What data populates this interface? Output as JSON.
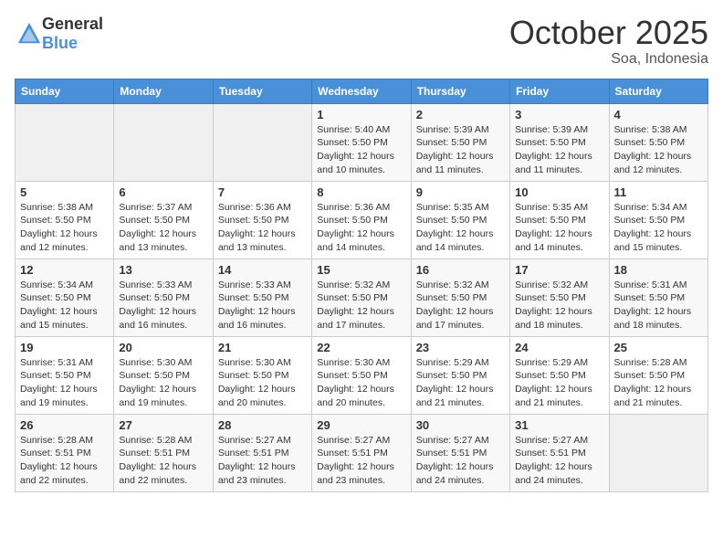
{
  "header": {
    "logo": {
      "general": "General",
      "blue": "Blue"
    },
    "title": "October 2025",
    "location": "Soa, Indonesia"
  },
  "calendar": {
    "weekdays": [
      "Sunday",
      "Monday",
      "Tuesday",
      "Wednesday",
      "Thursday",
      "Friday",
      "Saturday"
    ],
    "weeks": [
      [
        {
          "day": "",
          "info": ""
        },
        {
          "day": "",
          "info": ""
        },
        {
          "day": "",
          "info": ""
        },
        {
          "day": "1",
          "info": "Sunrise: 5:40 AM\nSunset: 5:50 PM\nDaylight: 12 hours\nand 10 minutes."
        },
        {
          "day": "2",
          "info": "Sunrise: 5:39 AM\nSunset: 5:50 PM\nDaylight: 12 hours\nand 11 minutes."
        },
        {
          "day": "3",
          "info": "Sunrise: 5:39 AM\nSunset: 5:50 PM\nDaylight: 12 hours\nand 11 minutes."
        },
        {
          "day": "4",
          "info": "Sunrise: 5:38 AM\nSunset: 5:50 PM\nDaylight: 12 hours\nand 12 minutes."
        }
      ],
      [
        {
          "day": "5",
          "info": "Sunrise: 5:38 AM\nSunset: 5:50 PM\nDaylight: 12 hours\nand 12 minutes."
        },
        {
          "day": "6",
          "info": "Sunrise: 5:37 AM\nSunset: 5:50 PM\nDaylight: 12 hours\nand 13 minutes."
        },
        {
          "day": "7",
          "info": "Sunrise: 5:36 AM\nSunset: 5:50 PM\nDaylight: 12 hours\nand 13 minutes."
        },
        {
          "day": "8",
          "info": "Sunrise: 5:36 AM\nSunset: 5:50 PM\nDaylight: 12 hours\nand 14 minutes."
        },
        {
          "day": "9",
          "info": "Sunrise: 5:35 AM\nSunset: 5:50 PM\nDaylight: 12 hours\nand 14 minutes."
        },
        {
          "day": "10",
          "info": "Sunrise: 5:35 AM\nSunset: 5:50 PM\nDaylight: 12 hours\nand 14 minutes."
        },
        {
          "day": "11",
          "info": "Sunrise: 5:34 AM\nSunset: 5:50 PM\nDaylight: 12 hours\nand 15 minutes."
        }
      ],
      [
        {
          "day": "12",
          "info": "Sunrise: 5:34 AM\nSunset: 5:50 PM\nDaylight: 12 hours\nand 15 minutes."
        },
        {
          "day": "13",
          "info": "Sunrise: 5:33 AM\nSunset: 5:50 PM\nDaylight: 12 hours\nand 16 minutes."
        },
        {
          "day": "14",
          "info": "Sunrise: 5:33 AM\nSunset: 5:50 PM\nDaylight: 12 hours\nand 16 minutes."
        },
        {
          "day": "15",
          "info": "Sunrise: 5:32 AM\nSunset: 5:50 PM\nDaylight: 12 hours\nand 17 minutes."
        },
        {
          "day": "16",
          "info": "Sunrise: 5:32 AM\nSunset: 5:50 PM\nDaylight: 12 hours\nand 17 minutes."
        },
        {
          "day": "17",
          "info": "Sunrise: 5:32 AM\nSunset: 5:50 PM\nDaylight: 12 hours\nand 18 minutes."
        },
        {
          "day": "18",
          "info": "Sunrise: 5:31 AM\nSunset: 5:50 PM\nDaylight: 12 hours\nand 18 minutes."
        }
      ],
      [
        {
          "day": "19",
          "info": "Sunrise: 5:31 AM\nSunset: 5:50 PM\nDaylight: 12 hours\nand 19 minutes."
        },
        {
          "day": "20",
          "info": "Sunrise: 5:30 AM\nSunset: 5:50 PM\nDaylight: 12 hours\nand 19 minutes."
        },
        {
          "day": "21",
          "info": "Sunrise: 5:30 AM\nSunset: 5:50 PM\nDaylight: 12 hours\nand 20 minutes."
        },
        {
          "day": "22",
          "info": "Sunrise: 5:30 AM\nSunset: 5:50 PM\nDaylight: 12 hours\nand 20 minutes."
        },
        {
          "day": "23",
          "info": "Sunrise: 5:29 AM\nSunset: 5:50 PM\nDaylight: 12 hours\nand 21 minutes."
        },
        {
          "day": "24",
          "info": "Sunrise: 5:29 AM\nSunset: 5:50 PM\nDaylight: 12 hours\nand 21 minutes."
        },
        {
          "day": "25",
          "info": "Sunrise: 5:28 AM\nSunset: 5:50 PM\nDaylight: 12 hours\nand 21 minutes."
        }
      ],
      [
        {
          "day": "26",
          "info": "Sunrise: 5:28 AM\nSunset: 5:51 PM\nDaylight: 12 hours\nand 22 minutes."
        },
        {
          "day": "27",
          "info": "Sunrise: 5:28 AM\nSunset: 5:51 PM\nDaylight: 12 hours\nand 22 minutes."
        },
        {
          "day": "28",
          "info": "Sunrise: 5:27 AM\nSunset: 5:51 PM\nDaylight: 12 hours\nand 23 minutes."
        },
        {
          "day": "29",
          "info": "Sunrise: 5:27 AM\nSunset: 5:51 PM\nDaylight: 12 hours\nand 23 minutes."
        },
        {
          "day": "30",
          "info": "Sunrise: 5:27 AM\nSunset: 5:51 PM\nDaylight: 12 hours\nand 24 minutes."
        },
        {
          "day": "31",
          "info": "Sunrise: 5:27 AM\nSunset: 5:51 PM\nDaylight: 12 hours\nand 24 minutes."
        },
        {
          "day": "",
          "info": ""
        }
      ]
    ]
  }
}
